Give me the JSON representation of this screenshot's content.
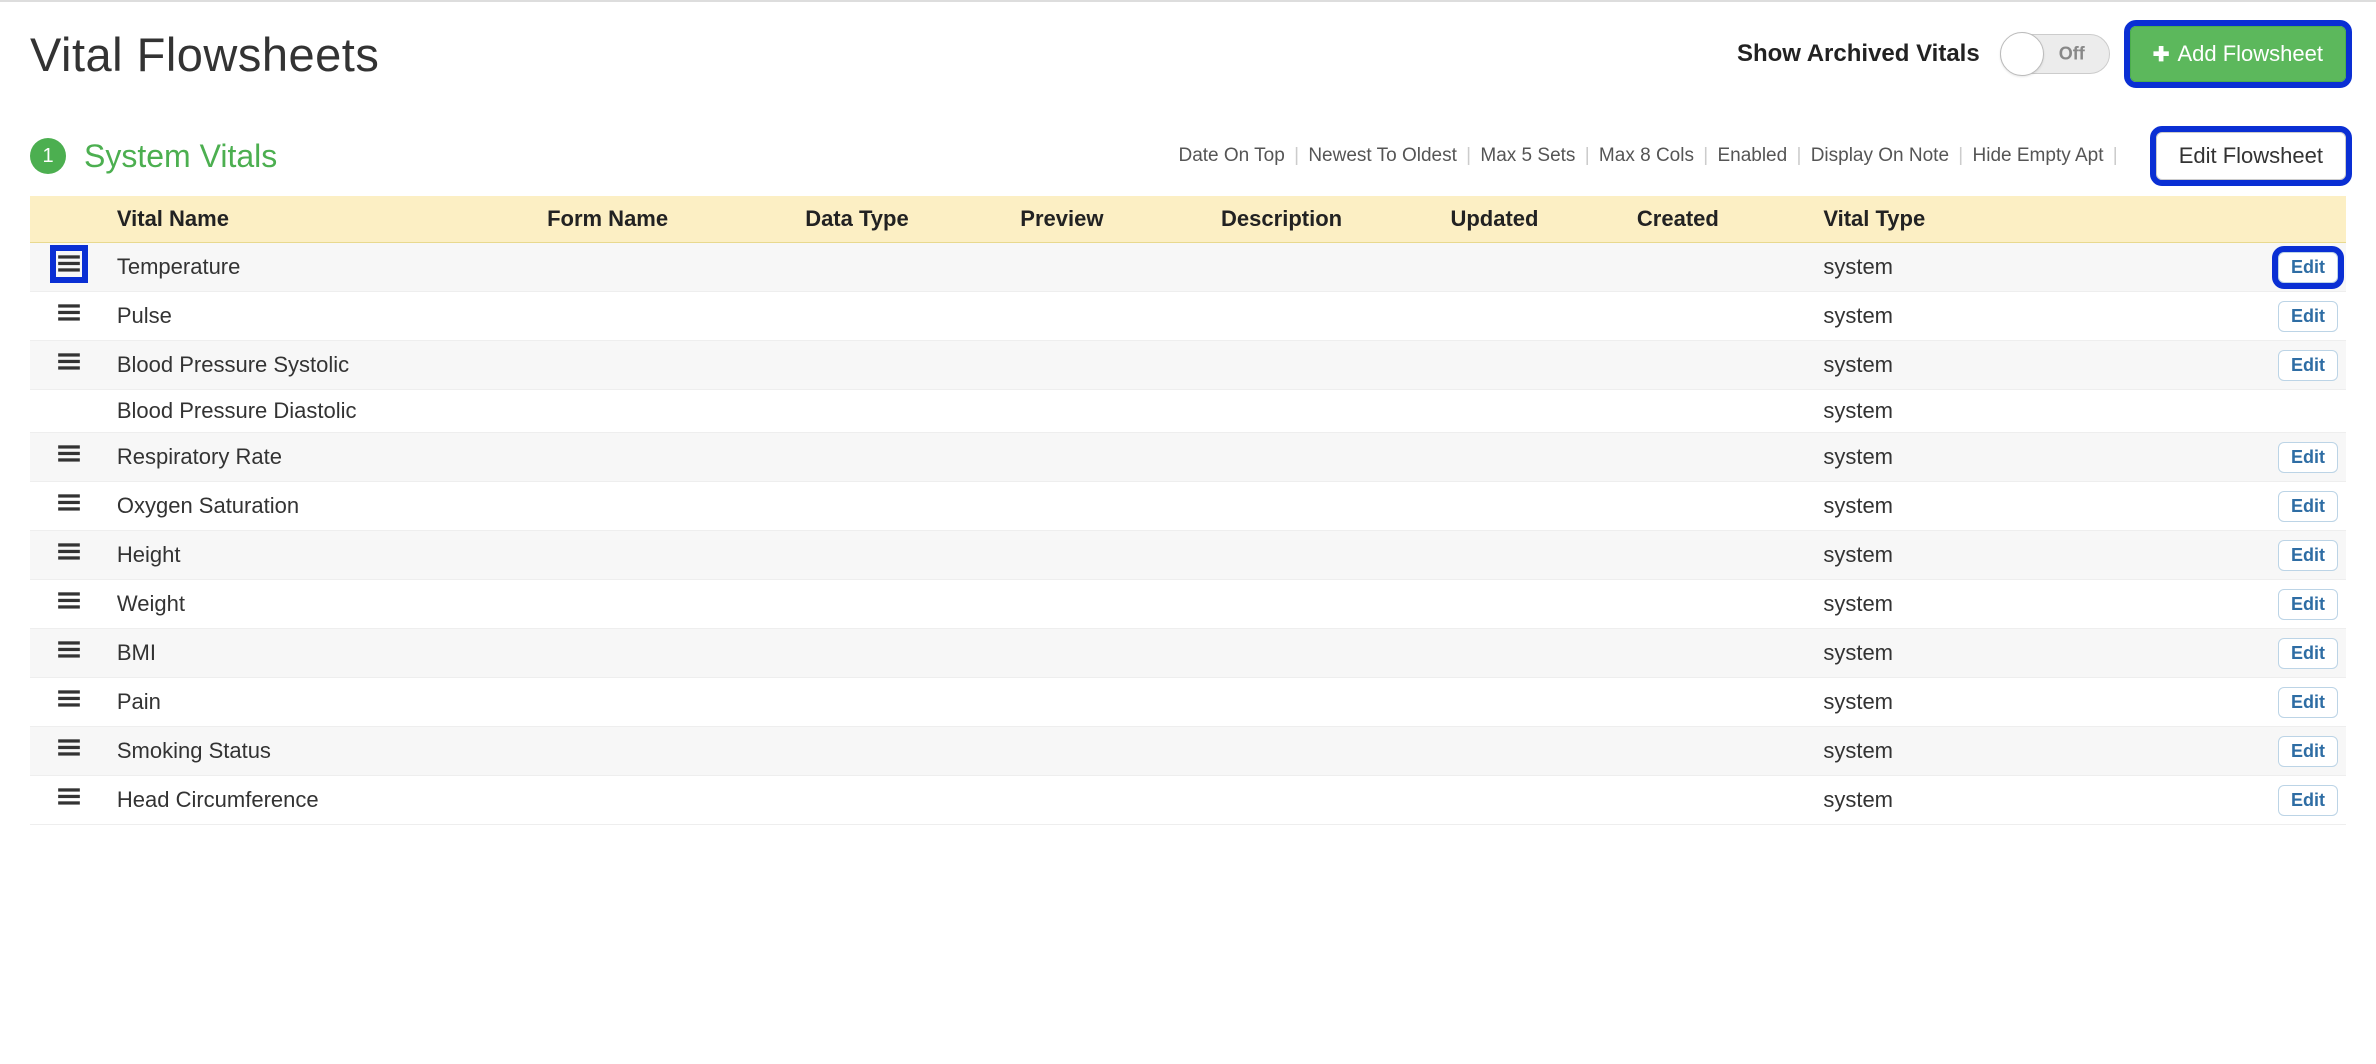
{
  "page_title": "Vital Flowsheets",
  "header": {
    "show_archived_label": "Show Archived Vitals",
    "toggle_state_label": "Off",
    "add_flowsheet_label": "Add Flowsheet"
  },
  "section": {
    "badge_number": "1",
    "title": "System Vitals",
    "meta": [
      "Date On Top",
      "Newest To Oldest",
      "Max 5 Sets",
      "Max 8 Cols",
      "Enabled",
      "Display On Note",
      "Hide Empty Apt"
    ],
    "edit_flowsheet_label": "Edit Flowsheet"
  },
  "columns": {
    "vital_name": "Vital Name",
    "form_name": "Form Name",
    "data_type": "Data Type",
    "preview": "Preview",
    "description": "Description",
    "updated": "Updated",
    "created": "Created",
    "vital_type": "Vital Type"
  },
  "row_edit_label": "Edit",
  "rows": [
    {
      "name": "Temperature",
      "form": "",
      "dtype": "",
      "preview": "",
      "desc": "",
      "updated": "",
      "created": "",
      "vtype": "system",
      "has_handle": true,
      "has_edit": true,
      "edit_highlight": true,
      "handle_highlight": true
    },
    {
      "name": "Pulse",
      "form": "",
      "dtype": "",
      "preview": "",
      "desc": "",
      "updated": "",
      "created": "",
      "vtype": "system",
      "has_handle": true,
      "has_edit": true,
      "edit_highlight": false,
      "handle_highlight": false
    },
    {
      "name": "Blood Pressure Systolic",
      "form": "",
      "dtype": "",
      "preview": "",
      "desc": "",
      "updated": "",
      "created": "",
      "vtype": "system",
      "has_handle": true,
      "has_edit": true,
      "edit_highlight": false,
      "handle_highlight": false
    },
    {
      "name": "Blood Pressure Diastolic",
      "form": "",
      "dtype": "",
      "preview": "",
      "desc": "",
      "updated": "",
      "created": "",
      "vtype": "system",
      "has_handle": false,
      "has_edit": false,
      "edit_highlight": false,
      "handle_highlight": false
    },
    {
      "name": "Respiratory Rate",
      "form": "",
      "dtype": "",
      "preview": "",
      "desc": "",
      "updated": "",
      "created": "",
      "vtype": "system",
      "has_handle": true,
      "has_edit": true,
      "edit_highlight": false,
      "handle_highlight": false
    },
    {
      "name": "Oxygen Saturation",
      "form": "",
      "dtype": "",
      "preview": "",
      "desc": "",
      "updated": "",
      "created": "",
      "vtype": "system",
      "has_handle": true,
      "has_edit": true,
      "edit_highlight": false,
      "handle_highlight": false
    },
    {
      "name": "Height",
      "form": "",
      "dtype": "",
      "preview": "",
      "desc": "",
      "updated": "",
      "created": "",
      "vtype": "system",
      "has_handle": true,
      "has_edit": true,
      "edit_highlight": false,
      "handle_highlight": false
    },
    {
      "name": "Weight",
      "form": "",
      "dtype": "",
      "preview": "",
      "desc": "",
      "updated": "",
      "created": "",
      "vtype": "system",
      "has_handle": true,
      "has_edit": true,
      "edit_highlight": false,
      "handle_highlight": false
    },
    {
      "name": "BMI",
      "form": "",
      "dtype": "",
      "preview": "",
      "desc": "",
      "updated": "",
      "created": "",
      "vtype": "system",
      "has_handle": true,
      "has_edit": true,
      "edit_highlight": false,
      "handle_highlight": false
    },
    {
      "name": "Pain",
      "form": "",
      "dtype": "",
      "preview": "",
      "desc": "",
      "updated": "",
      "created": "",
      "vtype": "system",
      "has_handle": true,
      "has_edit": true,
      "edit_highlight": false,
      "handle_highlight": false
    },
    {
      "name": "Smoking Status",
      "form": "",
      "dtype": "",
      "preview": "",
      "desc": "",
      "updated": "",
      "created": "",
      "vtype": "system",
      "has_handle": true,
      "has_edit": true,
      "edit_highlight": false,
      "handle_highlight": false
    },
    {
      "name": "Head Circumference",
      "form": "",
      "dtype": "",
      "preview": "",
      "desc": "",
      "updated": "",
      "created": "",
      "vtype": "system",
      "has_handle": true,
      "has_edit": true,
      "edit_highlight": false,
      "handle_highlight": false
    }
  ]
}
